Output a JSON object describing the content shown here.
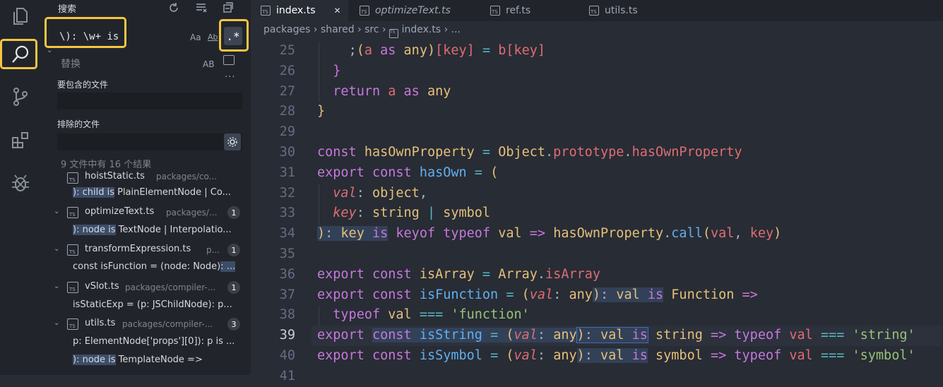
{
  "sidebar": {
    "title": "搜索",
    "search": {
      "value": "\\): \\w+ is",
      "case_label": "Aa",
      "word_label": "Ab",
      "regex_label": ".*"
    },
    "replace": {
      "placeholder": "替换",
      "preserve_label": "AB"
    },
    "include_label": "要包含的文件",
    "exclude_label": "排除的文件",
    "more_label": "···",
    "summary": "9 文件中有 16 个结果",
    "files": [
      {
        "name": "hoistStatic.ts",
        "path": "packages/co..."
      },
      {
        "name": "optimizeText.ts",
        "path": "packages/...",
        "count": "1"
      },
      {
        "name": "transformExpression.ts",
        "path": "p...",
        "count": "1"
      },
      {
        "name": "vSlot.ts",
        "path": "packages/compiler-...",
        "count": "1"
      },
      {
        "name": "utils.ts",
        "path": "packages/compiler-...",
        "count": "3"
      }
    ],
    "matches": [
      {
        "pre": "",
        "hit": "): child is",
        "post": " PlainElementNode | Co..."
      },
      {
        "pre": "",
        "hit": "): node is",
        "post": " TextNode | Interpolatio..."
      },
      {
        "pre": "const isFunction = (node: Node)",
        "hit": ": ...",
        "post": ""
      },
      {
        "pre": "isStaticExp = (p: JSChildNode): p...",
        "hit": "",
        "post": ""
      },
      {
        "pre": "p: ElementNode['props'][0]): p is ...",
        "hit": "",
        "post": ""
      },
      {
        "pre": "",
        "hit": "): node is",
        "post": " TemplateNode =>"
      }
    ]
  },
  "tabs": [
    {
      "label": "index.ts",
      "close": "✕"
    },
    {
      "label": "optimizeText.ts"
    },
    {
      "label": "ref.ts"
    },
    {
      "label": "utils.ts"
    }
  ],
  "breadcrumb": {
    "parts": [
      "packages",
      "shared",
      "src",
      "index.ts",
      "..."
    ],
    "sep": "›"
  },
  "editor": {
    "line_numbers": [
      "25",
      "26",
      "27",
      "28",
      "29",
      "30",
      "31",
      "32",
      "33",
      "34",
      "35",
      "36",
      "37",
      "38",
      "39",
      "40",
      "41"
    ],
    "current_line": "39"
  },
  "colors": {
    "highlight": "#f5c542",
    "accent": "#3f6db5"
  },
  "icons": [
    "files-icon",
    "search-icon",
    "source-control-icon",
    "extensions-icon",
    "debug-icon",
    "refresh-icon",
    "clear-results-icon",
    "collapse-all-icon",
    "settings-gear-icon",
    "typescript-file-icon"
  ]
}
